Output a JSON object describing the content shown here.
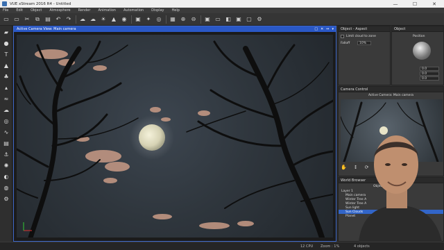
{
  "window": {
    "title": "VUE xStream 2016 R4 - Untitled",
    "minimize": "—",
    "maximize": "☐",
    "close": "✕"
  },
  "menu": [
    "File",
    "Edit",
    "Object",
    "Atmosphere",
    "Render",
    "Animation",
    "Automation",
    "Display",
    "Help"
  ],
  "toolbar": {
    "groups": [
      [
        "open-icon",
        "save-icon",
        "cut-icon",
        "copy-icon",
        "paste-icon",
        "undo-icon",
        "redo-icon"
      ],
      [
        "atmosphere-icon",
        "cloud-icon",
        "sun-icon",
        "terrain-icon",
        "render-icon"
      ],
      [
        "camera-icon",
        "light-icon",
        "lens-icon"
      ],
      [
        "layout-icon",
        "zoom-in-icon",
        "zoom-out-icon"
      ],
      [
        "render-area-icon",
        "screen-icon",
        "camera-view-icon",
        "capture-icon",
        "display-icon",
        "settings-icon"
      ]
    ],
    "glyphs": [
      "▭",
      "▭",
      "✂",
      "⧉",
      "▤",
      "↶",
      "↷",
      "☁",
      "☁",
      "☀",
      "▲",
      "◉",
      "▣",
      "✦",
      "◎",
      "▦",
      "⊕",
      "⊖",
      "▣",
      "▭",
      "◧",
      "▣",
      "▢",
      "⚙"
    ]
  },
  "left_tools": [
    "cube-icon",
    "sphere-icon",
    "text-icon",
    "terrain-icon",
    "plant-icon",
    "rock-icon",
    "water-icon",
    "cloud-icon",
    "spiral-icon",
    "spline-icon",
    "library-icon",
    "path-icon",
    "light-icon",
    "camera-icon",
    "material-icon",
    "settings-icon"
  ],
  "left_glyphs": [
    "▰",
    "●",
    "T",
    "▲",
    "♣",
    "▴",
    "≈",
    "☁",
    "◎",
    "∿",
    "▤",
    "⚓",
    "✺",
    "◐",
    "◍",
    "⚙"
  ],
  "viewport": {
    "title": "Active Camera View: Main camera",
    "controls": [
      "□",
      "✕",
      "↔",
      "▾"
    ]
  },
  "right": {
    "object_aspect": {
      "title": "Object - Aspect",
      "check_label": "Limit cloud to zone",
      "falloff_label": "Falloff",
      "falloff_value": "10%"
    },
    "object": {
      "title": "Object",
      "position_label": "Position",
      "x": "0.0",
      "y": "0.0",
      "z": "0.0"
    },
    "camera_control": {
      "title": "Camera Control",
      "active": "Active Camera: Main camera"
    },
    "world_browser": {
      "title": "World Browser",
      "tab": "Objects",
      "items": [
        {
          "label": "Layer 1",
          "selected": false
        },
        {
          "label": "Main camera",
          "selected": false
        },
        {
          "label": "Winter Tree A",
          "selected": false
        },
        {
          "label": "Winter Tree A",
          "selected": false
        },
        {
          "label": "Sun light",
          "selected": false
        },
        {
          "label": "Sun Clouds",
          "selected": true
        },
        {
          "label": "Planet",
          "selected": false
        }
      ]
    }
  },
  "status": {
    "cpu": "12 CPU",
    "zoom": "Zoom : 1%",
    "objects": "4 objects"
  }
}
